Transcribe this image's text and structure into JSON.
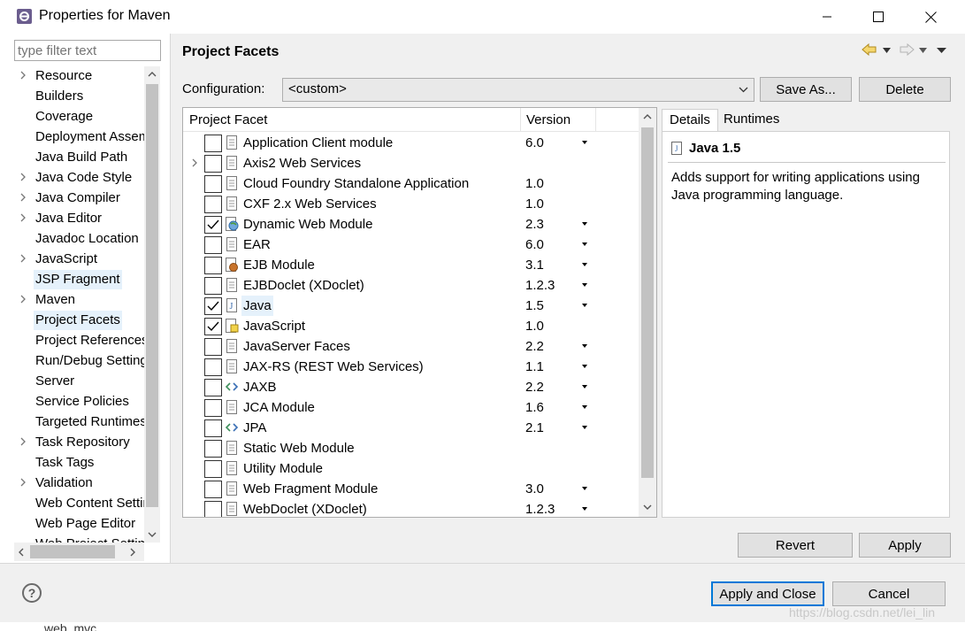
{
  "window": {
    "title": "Properties for Maven"
  },
  "left": {
    "filter_placeholder": "type filter text",
    "items": [
      {
        "label": "Resource",
        "expandable": true,
        "selected": false
      },
      {
        "label": "Builders",
        "expandable": false,
        "selected": false
      },
      {
        "label": "Coverage",
        "expandable": false,
        "selected": false
      },
      {
        "label": "Deployment Assembly",
        "expandable": false,
        "selected": false
      },
      {
        "label": "Java Build Path",
        "expandable": false,
        "selected": false
      },
      {
        "label": "Java Code Style",
        "expandable": true,
        "selected": false
      },
      {
        "label": "Java Compiler",
        "expandable": true,
        "selected": false
      },
      {
        "label": "Java Editor",
        "expandable": true,
        "selected": false
      },
      {
        "label": "Javadoc Location",
        "expandable": false,
        "selected": false
      },
      {
        "label": "JavaScript",
        "expandable": true,
        "selected": false
      },
      {
        "label": "JSP Fragment",
        "expandable": false,
        "selected": true
      },
      {
        "label": "Maven",
        "expandable": true,
        "selected": false
      },
      {
        "label": "Project Facets",
        "expandable": false,
        "selected": true
      },
      {
        "label": "Project References",
        "expandable": false,
        "selected": false
      },
      {
        "label": "Run/Debug Settings",
        "expandable": false,
        "selected": false
      },
      {
        "label": "Server",
        "expandable": false,
        "selected": false
      },
      {
        "label": "Service Policies",
        "expandable": false,
        "selected": false
      },
      {
        "label": "Targeted Runtimes",
        "expandable": false,
        "selected": false
      },
      {
        "label": "Task Repository",
        "expandable": true,
        "selected": false
      },
      {
        "label": "Task Tags",
        "expandable": false,
        "selected": false
      },
      {
        "label": "Validation",
        "expandable": true,
        "selected": false
      },
      {
        "label": "Web Content Settings",
        "expandable": false,
        "selected": false
      },
      {
        "label": "Web Page Editor",
        "expandable": false,
        "selected": false
      },
      {
        "label": "Web Project Settings",
        "expandable": false,
        "selected": false
      }
    ]
  },
  "main": {
    "title": "Project Facets",
    "config_label": "Configuration:",
    "config_value": "<custom>",
    "save_as": "Save As...",
    "delete": "Delete",
    "col_facet": "Project Facet",
    "col_version": "Version",
    "facets": [
      {
        "name": "Application Client module",
        "version": "6.0",
        "checked": false,
        "icon": "page-icon",
        "dropdown": true
      },
      {
        "name": "Axis2 Web Services",
        "version": "",
        "checked": false,
        "icon": "page-icon",
        "dropdown": false,
        "expandable": true
      },
      {
        "name": "Cloud Foundry Standalone Application",
        "version": "1.0",
        "checked": false,
        "icon": "page-icon",
        "dropdown": false
      },
      {
        "name": "CXF 2.x Web Services",
        "version": "1.0",
        "checked": false,
        "icon": "page-icon",
        "dropdown": false
      },
      {
        "name": "Dynamic Web Module",
        "version": "2.3",
        "checked": true,
        "icon": "web-module-icon",
        "dropdown": true
      },
      {
        "name": "EAR",
        "version": "6.0",
        "checked": false,
        "icon": "page-icon",
        "dropdown": true
      },
      {
        "name": "EJB Module",
        "version": "3.1",
        "checked": false,
        "icon": "ejb-icon",
        "dropdown": true
      },
      {
        "name": "EJBDoclet (XDoclet)",
        "version": "1.2.3",
        "checked": false,
        "icon": "page-icon",
        "dropdown": true
      },
      {
        "name": "Java",
        "version": "1.5",
        "checked": true,
        "icon": "java-icon",
        "dropdown": true,
        "selected": true
      },
      {
        "name": "JavaScript",
        "version": "1.0",
        "checked": true,
        "icon": "javascript-icon",
        "dropdown": false
      },
      {
        "name": "JavaServer Faces",
        "version": "2.2",
        "checked": false,
        "icon": "page-icon",
        "dropdown": true
      },
      {
        "name": "JAX-RS (REST Web Services)",
        "version": "1.1",
        "checked": false,
        "icon": "page-icon",
        "dropdown": true
      },
      {
        "name": "JAXB",
        "version": "2.2",
        "checked": false,
        "icon": "arrows-icon",
        "dropdown": true
      },
      {
        "name": "JCA Module",
        "version": "1.6",
        "checked": false,
        "icon": "page-icon",
        "dropdown": true
      },
      {
        "name": "JPA",
        "version": "2.1",
        "checked": false,
        "icon": "arrows-icon",
        "dropdown": true
      },
      {
        "name": "Static Web Module",
        "version": "",
        "checked": false,
        "icon": "page-icon",
        "dropdown": false
      },
      {
        "name": "Utility Module",
        "version": "",
        "checked": false,
        "icon": "page-icon",
        "dropdown": false
      },
      {
        "name": "Web Fragment Module",
        "version": "3.0",
        "checked": false,
        "icon": "page-icon",
        "dropdown": true
      },
      {
        "name": "WebDoclet (XDoclet)",
        "version": "1.2.3",
        "checked": false,
        "icon": "page-icon",
        "dropdown": true
      }
    ],
    "tabs": [
      "Details",
      "Runtimes"
    ],
    "details_title": "Java 1.5",
    "details_text": "Adds support for writing applications using Java programming language.",
    "revert": "Revert",
    "apply": "Apply"
  },
  "footer": {
    "apply_close": "Apply and Close",
    "cancel": "Cancel",
    "help_glyph": "?",
    "watermark": "https://blog.csdn.net/lei_lin",
    "underlying_text": "web_mvc"
  },
  "colors": {
    "selection": "#e5f1fb",
    "default_button_border": "#0078d7",
    "dialog_bg": "#f0f0f0"
  }
}
